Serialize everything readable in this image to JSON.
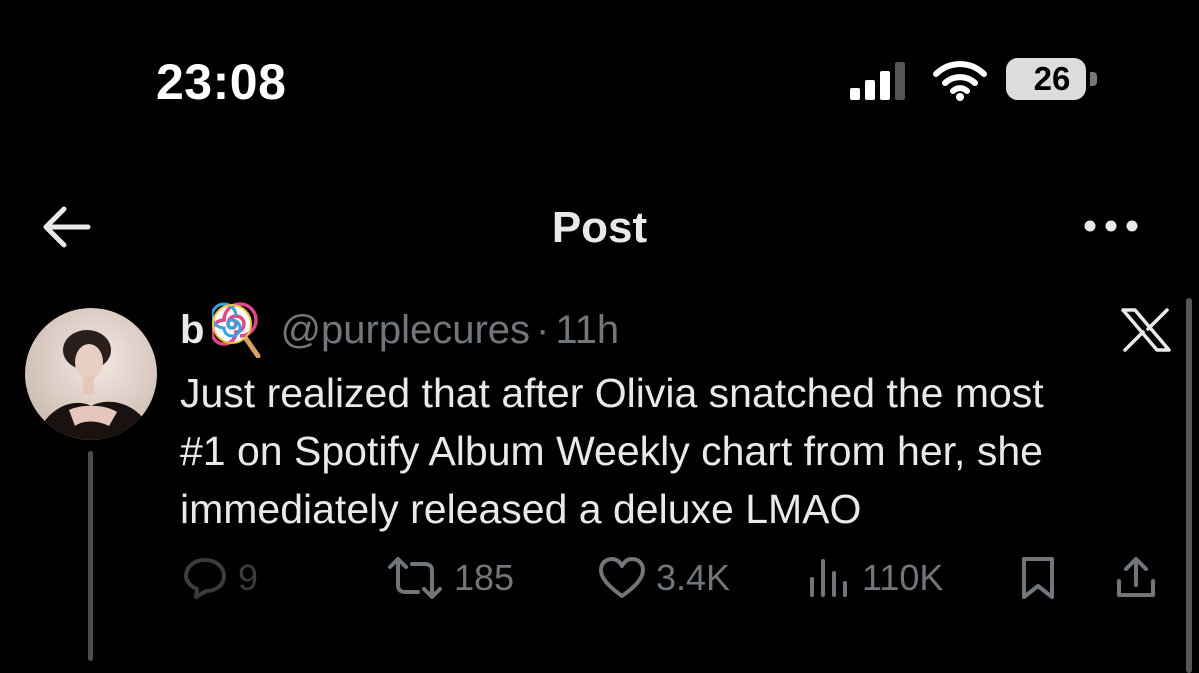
{
  "status_bar": {
    "time": "23:08",
    "battery_level": "26",
    "signal_icon": "cellular-signal-icon",
    "wifi_icon": "wifi-icon",
    "colors": {
      "text": "#ffffff",
      "battery": "#dcdcdc"
    }
  },
  "header": {
    "title": "Post",
    "back_icon": "back-arrow-icon",
    "more_icon": "more-options-icon"
  },
  "post": {
    "display_name": "b",
    "name_emoji": "lollipop-icon",
    "handle": "@purplecures",
    "separator": "·",
    "time_ago": "11h",
    "logo_icon": "x-logo-icon",
    "text_lines": [
      "Just realized that after Olivia snatched the most",
      "#1 on Spotify Album Weekly chart from her, she",
      "immediately released a deluxe LMAO"
    ]
  },
  "actions": {
    "replies": "9",
    "reposts": "185",
    "likes": "3.4K",
    "views": "110K",
    "bookmark_icon": "bookmark-icon",
    "share_icon": "share-icon"
  },
  "colors": {
    "background": "#000000",
    "primary_text": "#e7e9ea",
    "secondary_text": "#71767b"
  }
}
